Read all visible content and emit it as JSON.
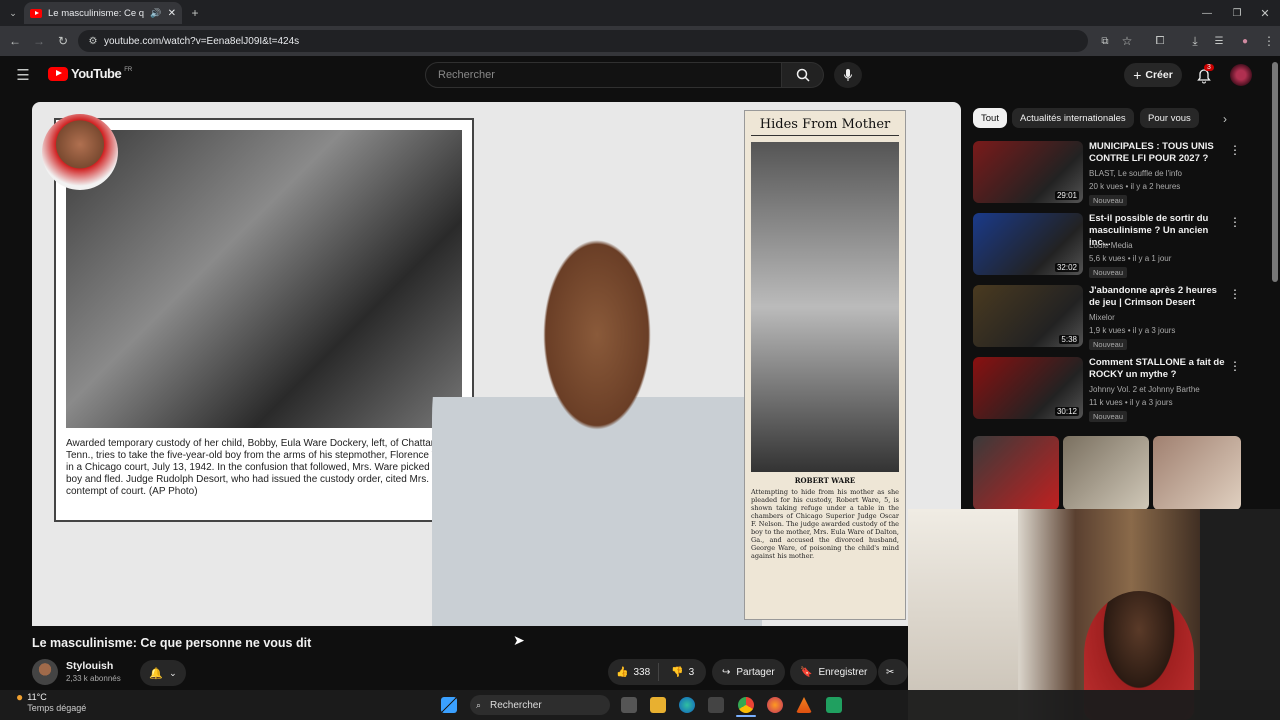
{
  "browser": {
    "tab_title": "Le masculinisme: Ce que personne ne vous dit - YouTube",
    "url": "youtube.com/watch?v=Eena8elJ09I&t=424s"
  },
  "youtube": {
    "logo_text": "YouTube",
    "region": "FR",
    "search_placeholder": "Rechercher",
    "create_label": "Créer",
    "notification_count": "3"
  },
  "video": {
    "title": "Le masculinisme: Ce que personne ne vous dit",
    "channel": "Stylouish",
    "subscribers": "2,33 k abonnés",
    "likes": "338",
    "dislikes": "3",
    "share_label": "Partager",
    "save_label": "Enregistrer",
    "photo_caption": "Awarded temporary custody of her child, Bobby, Eula Ware Dockery, left, of Chattanooga, Tenn., tries to take the five-year-old boy from the arms of his stepmother, Florence Ware, in a Chicago court, July 13, 1942. In the confusion that followed, Mrs. Ware picked up the boy and fled. Judge Rudolph Desort, who had issued the custody order, cited Mrs. ... contempt of court. (AP Photo)",
    "clipping_title": "Hides From Mother",
    "clipping_name": "ROBERT WARE",
    "clipping_text": "Attempting to hide from his mother as she pleaded for his custody, Robert Ware, 5, is shown taking refuge under a table in the chambers of Chicago Superior Judge Oscar F. Nelson. The judge awarded custody of the boy to the mother, Mrs. Eula Ware of Dalton, Ga., and accused the divorced husband, George Ware, of poisoning the child's mind against his mother."
  },
  "sidebar": {
    "chips": [
      "Tout",
      "Actualités internationales",
      "Pour vous"
    ],
    "recommendations": [
      {
        "title": "MUNICIPALES : TOUS UNIS CONTRE LFI POUR 2027 ?",
        "channel": "BLAST, Le souffle de l'info",
        "meta": "20 k vues • il y a 2 heures",
        "badge": "Nouveau",
        "duration": "29:01",
        "thumb_color": "#7a1a1a"
      },
      {
        "title": "Est-il possible de sortir du masculinisme ? Un ancien inc...",
        "channel": "Loule Media",
        "meta": "5,6 k vues • il y a 1 jour",
        "badge": "Nouveau",
        "duration": "32:02",
        "thumb_color": "#1a3a8a"
      },
      {
        "title": "J'abandonne après 2 heures de jeu | Crimson Desert",
        "channel": "Mixelor",
        "meta": "1,9 k vues • il y a 3 jours",
        "badge": "Nouveau",
        "duration": "5:38",
        "thumb_color": "#4a3a20"
      },
      {
        "title": "Comment STALLONE a fait de ROCKY un mythe ?",
        "channel": "Johnny Vol. 2 et Johnny Barthe",
        "meta": "11 k vues • il y a 3 jours",
        "badge": "Nouveau",
        "duration": "30:12",
        "thumb_color": "#8a1010"
      }
    ]
  },
  "taskbar": {
    "temperature": "11°C",
    "weather": "Temps dégagé",
    "search_label": "Rechercher"
  }
}
